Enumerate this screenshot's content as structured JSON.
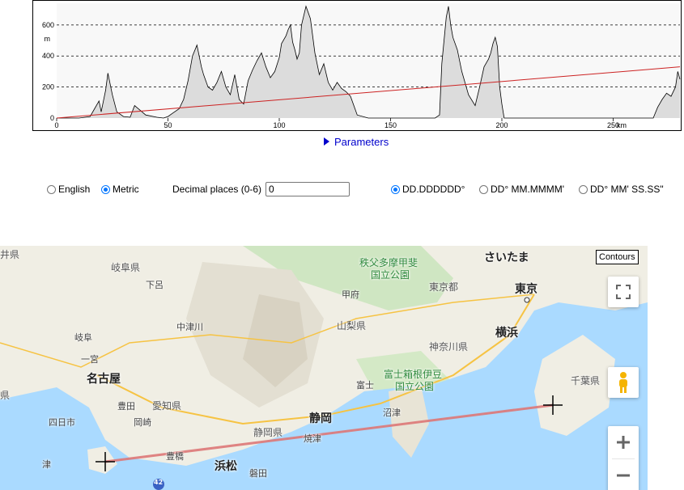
{
  "profile": {
    "y_unit": "m",
    "y_ticks": [
      "600",
      "400",
      "200",
      "0"
    ],
    "x_ticks": [
      "0",
      "50",
      "100",
      "150",
      "200",
      "250"
    ],
    "x_unit": "km",
    "ylim": [
      0,
      740
    ],
    "xlim": [
      0,
      280
    ],
    "colors": {
      "fill": "#dcdcdc",
      "line": "#000000",
      "trend": "#cc2222",
      "grid": "#000000"
    },
    "elevation": {
      "x": [
        0,
        10,
        15,
        17,
        19,
        20,
        22,
        23,
        25,
        27,
        30,
        33,
        35,
        40,
        45,
        48,
        50,
        52,
        55,
        57,
        59,
        61,
        63,
        65,
        66,
        68,
        70,
        72,
        74,
        76,
        78,
        80,
        82,
        84,
        86,
        88,
        90,
        92,
        94,
        96,
        98,
        100,
        101,
        103,
        104,
        105,
        106,
        107,
        108,
        109,
        110,
        112,
        114,
        116,
        118,
        120,
        122,
        124,
        126,
        128,
        130,
        132,
        135,
        140,
        150,
        160,
        170,
        172,
        173,
        175,
        176,
        177,
        178,
        180,
        182,
        185,
        188,
        190,
        192,
        194,
        195,
        196,
        197,
        198,
        199,
        200,
        201,
        205,
        210,
        220,
        240,
        260,
        268,
        270,
        272,
        274,
        276,
        278,
        279,
        280
      ],
      "y": [
        0,
        0,
        10,
        60,
        110,
        40,
        180,
        290,
        150,
        40,
        10,
        5,
        80,
        20,
        5,
        0,
        10,
        30,
        60,
        120,
        240,
        400,
        470,
        330,
        280,
        200,
        180,
        230,
        300,
        200,
        150,
        280,
        120,
        90,
        240,
        310,
        370,
        420,
        330,
        260,
        300,
        390,
        480,
        530,
        570,
        600,
        490,
        440,
        380,
        420,
        600,
        720,
        640,
        420,
        280,
        350,
        230,
        180,
        230,
        190,
        170,
        140,
        20,
        0,
        0,
        0,
        0,
        20,
        350,
        650,
        720,
        600,
        520,
        440,
        300,
        150,
        80,
        200,
        330,
        380,
        420,
        480,
        520,
        460,
        200,
        90,
        0,
        0,
        0,
        0,
        0,
        0,
        0,
        70,
        120,
        160,
        140,
        200,
        300,
        250
      ]
    },
    "trend": {
      "start": 0,
      "end": 330
    }
  },
  "parameters_label": "Parameters",
  "units": {
    "english": "English",
    "metric": "Metric",
    "selected": "metric"
  },
  "decimal": {
    "label": "Decimal places (0-6)",
    "value": "0"
  },
  "formats": {
    "dd": "DD.DDDDDD°",
    "ddm": "DD° MM.MMMM'",
    "dms": "DD° MM' SS.SS\"",
    "selected": "dd"
  },
  "map": {
    "contours_label": "Contours",
    "labels": {
      "fukui": "井県",
      "gifu_pref": "岐阜県",
      "gero": "下呂",
      "chichibu": "秩父多摩甲斐",
      "park": "国立公園",
      "saitama": "さいたま",
      "tokyo_to": "東京都",
      "tokyo": "東京",
      "kofu": "甲府",
      "nakatsugawa": "中津川",
      "yamanashi": "山梨県",
      "gifu": "岐阜",
      "yokohama": "横浜",
      "kanagawa": "神奈川県",
      "ichinomiya": "一宮",
      "nagoya": "名古屋",
      "fuji": "富士",
      "fuji_hakone": "富士箱根伊豆",
      "chiba": "千葉県",
      "toyota": "豊田",
      "aichi": "愛知県",
      "mie": "県",
      "okazaki": "岡崎",
      "numazu": "沼津",
      "shizuoka": "静岡",
      "yokkaichi": "四日市",
      "shizuoka_pref": "静岡県",
      "yaizu": "焼津",
      "toyohashi": "豊橋",
      "tsu": "津",
      "hamamatsu": "浜松",
      "iwata": "磐田",
      "route": "42"
    }
  }
}
